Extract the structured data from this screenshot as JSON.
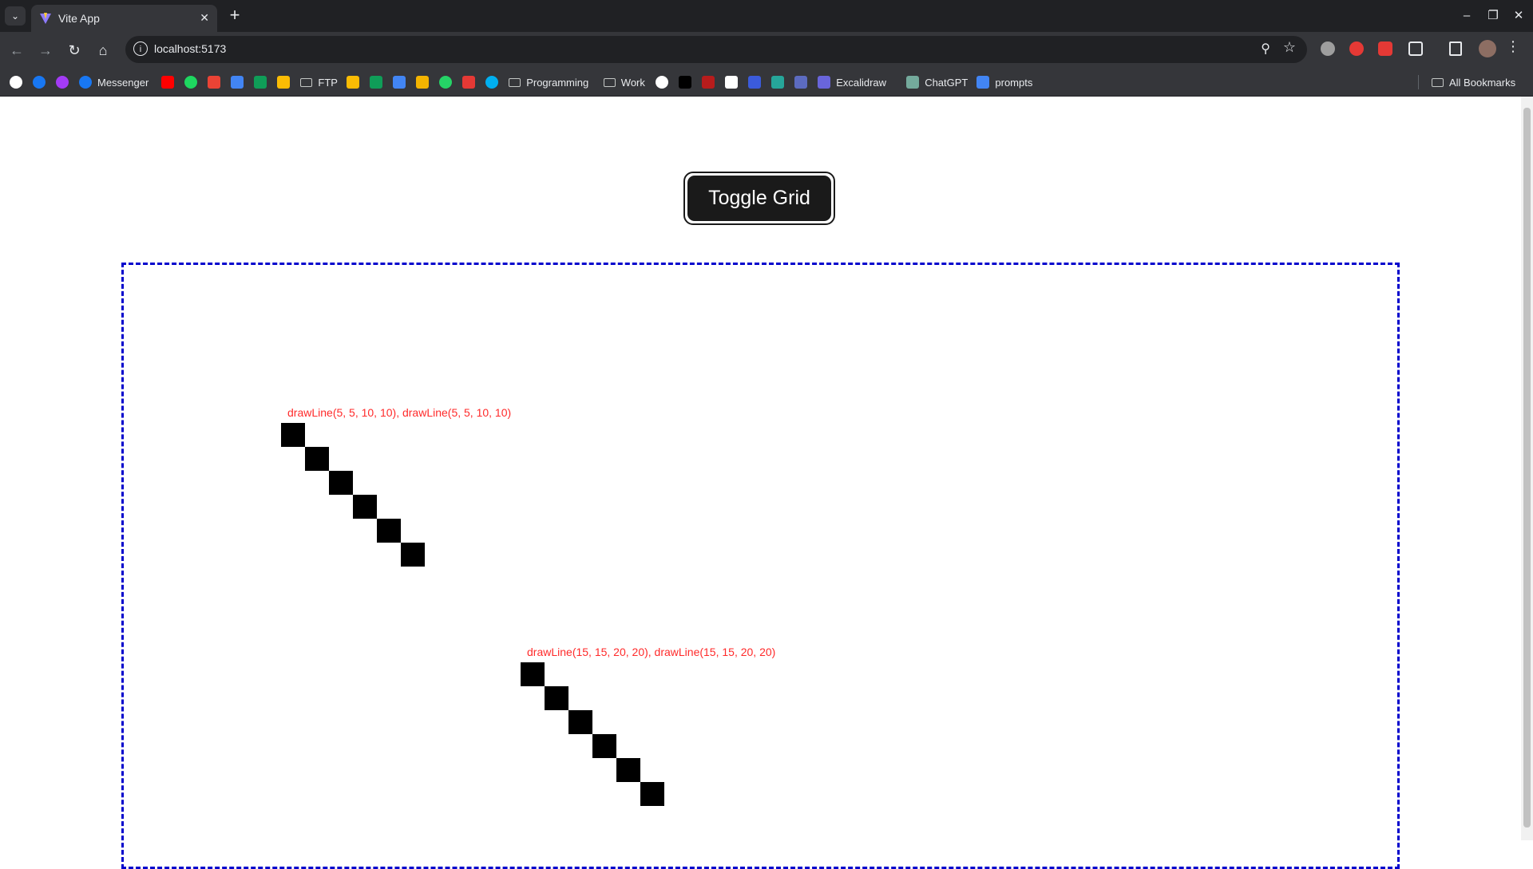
{
  "browser": {
    "tab": {
      "title": "Vite App"
    },
    "url": "localhost:5173",
    "bookmarks": [
      {
        "label": "",
        "icon": "google-icon",
        "color": "#ffffff"
      },
      {
        "label": "",
        "icon": "facebook-icon",
        "color": "#1877f2"
      },
      {
        "label": "",
        "icon": "messenger-icon",
        "color": "#a33bf5"
      },
      {
        "label": "Messenger",
        "icon": "facebook-icon",
        "color": "#1877f2"
      },
      {
        "label": "",
        "icon": "youtube-icon",
        "color": "#ff0000"
      },
      {
        "label": "",
        "icon": "spotify-icon",
        "color": "#1ed760"
      },
      {
        "label": "",
        "icon": "gmail-icon",
        "color": "#ea4335"
      },
      {
        "label": "",
        "icon": "calendar-icon",
        "color": "#4285f4"
      },
      {
        "label": "",
        "icon": "drive-icon",
        "color": "#0f9d58"
      },
      {
        "label": "",
        "icon": "photos-icon",
        "color": "#fbbc04"
      },
      {
        "label": "FTP",
        "icon": "folder-icon"
      },
      {
        "label": "",
        "icon": "keep-icon",
        "color": "#fbbc04"
      },
      {
        "label": "",
        "icon": "sheets-icon",
        "color": "#0f9d58"
      },
      {
        "label": "",
        "icon": "docs-icon",
        "color": "#4285f4"
      },
      {
        "label": "",
        "icon": "slides-icon",
        "color": "#f4b400"
      },
      {
        "label": "",
        "icon": "whatsapp-icon",
        "color": "#25d366"
      },
      {
        "label": "",
        "icon": "app-icon",
        "color": "#e53935"
      },
      {
        "label": "",
        "icon": "skype-icon",
        "color": "#00aff0"
      },
      {
        "label": "Programming",
        "icon": "folder-icon"
      },
      {
        "label": "Work",
        "icon": "folder-icon"
      },
      {
        "label": "",
        "icon": "github-icon",
        "color": "#ffffff"
      },
      {
        "label": "",
        "icon": "x-icon",
        "color": "#000000"
      },
      {
        "label": "",
        "icon": "app-icon",
        "color": "#b71c1c"
      },
      {
        "label": "",
        "icon": "app-icon",
        "color": "#ffffff"
      },
      {
        "label": "",
        "icon": "app-icon",
        "color": "#3b5bdb"
      },
      {
        "label": "",
        "icon": "app-icon",
        "color": "#26a69a"
      },
      {
        "label": "",
        "icon": "app-icon",
        "color": "#5c6bc0"
      },
      {
        "label": "Excalidraw",
        "icon": "excalidraw-icon",
        "color": "#6965db"
      },
      {
        "label": "ChatGPT",
        "icon": "chatgpt-icon",
        "color": "#74aa9c"
      },
      {
        "label": "prompts",
        "icon": "docs-icon",
        "color": "#4285f4"
      }
    ],
    "all_bookmarks": "All Bookmarks"
  },
  "page": {
    "toggle_button": "Toggle Grid",
    "line1_label": "drawLine(5, 5, 10, 10), drawLine(5, 5, 10, 10)",
    "line2_label": "drawLine(15, 15, 20, 20), drawLine(15, 15, 20, 20)",
    "label_color": "#ff2a2a",
    "frame_color": "#0000cc"
  }
}
